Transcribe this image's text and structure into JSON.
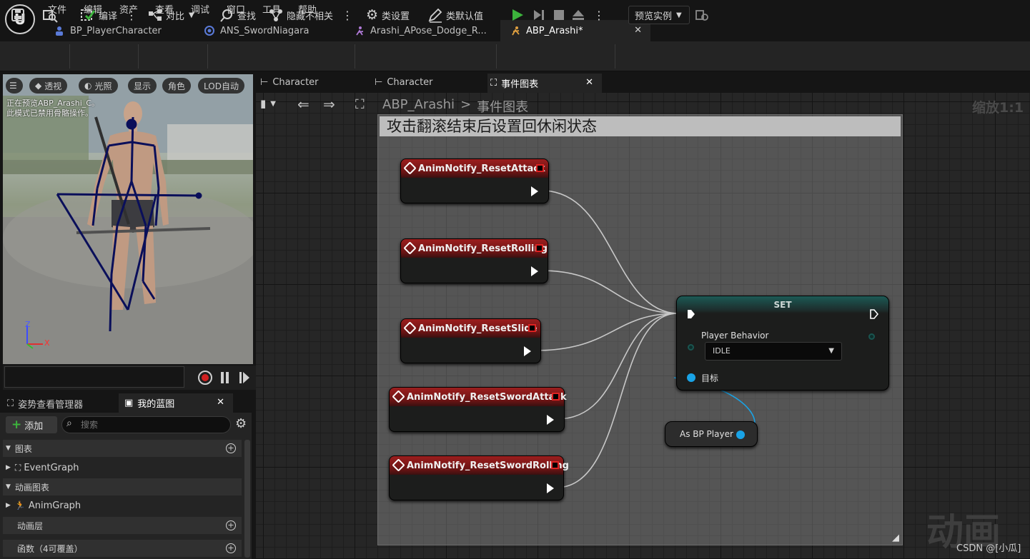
{
  "menu": [
    "文件",
    "编辑",
    "资产",
    "查看",
    "调试",
    "窗口",
    "工具",
    "帮助"
  ],
  "tabs": [
    "BP_PlayerCharacter",
    "ANS_SwordNiagara",
    "Arashi_APose_Dodge_R...",
    "ABP_Arashi*"
  ],
  "toolbar": {
    "compile": "编译",
    "diff": "对比",
    "find": "查找",
    "hide_unrelated": "隐藏不相关",
    "class_settings": "类设置",
    "class_defaults": "类默认值",
    "preview_instance": "预览实例"
  },
  "viewport": {
    "buttons": [
      "透视",
      "光照",
      "显示",
      "角色",
      "LOD自动"
    ],
    "message_line1": "正在预览ABP_Arashi_C。",
    "message_line2": "此模式已禁用骨骼操作。",
    "axis_z": "Z",
    "axis_x": "X"
  },
  "panels": {
    "pose_watch": "姿势查看管理器",
    "my_blueprint": "我的蓝图",
    "add": "添加",
    "search_placeholder": "搜索"
  },
  "tree": {
    "graphs": "图表",
    "event_graph": "EventGraph",
    "anim_graphs": "动画图表",
    "anim_graph": "AnimGraph",
    "anim_layers": "动画层",
    "functions": "函数（4可覆盖）"
  },
  "graph_tabs": [
    "Character",
    "Character",
    "事件图表"
  ],
  "breadcrumb": {
    "root": "ABP_Arashi",
    "separator": ">",
    "current": "事件图表"
  },
  "zoom": "缩放1:1",
  "comment": "攻击翻滚结束后设置回休闲状态",
  "nodes": {
    "n1": "AnimNotify_ResetAttack",
    "n2": "AnimNotify_ResetRolling",
    "n3": "AnimNotify_ResetSlide",
    "n4": "AnimNotify_ResetSwordAttack",
    "n5": "AnimNotify_ResetSwordRolling"
  },
  "set_node": {
    "title": "SET",
    "var_name": "Player Behavior",
    "value": "IDLE",
    "target": "目标"
  },
  "as_node": {
    "label": "As BP Player"
  },
  "watermark": "动画",
  "credit": "CSDN @[小瓜]",
  "colors": {
    "event_red": "#9c1e1e",
    "set_teal": "#1c5a55",
    "object_pin": "#19a3e6",
    "play_green": "#3cb43c"
  }
}
